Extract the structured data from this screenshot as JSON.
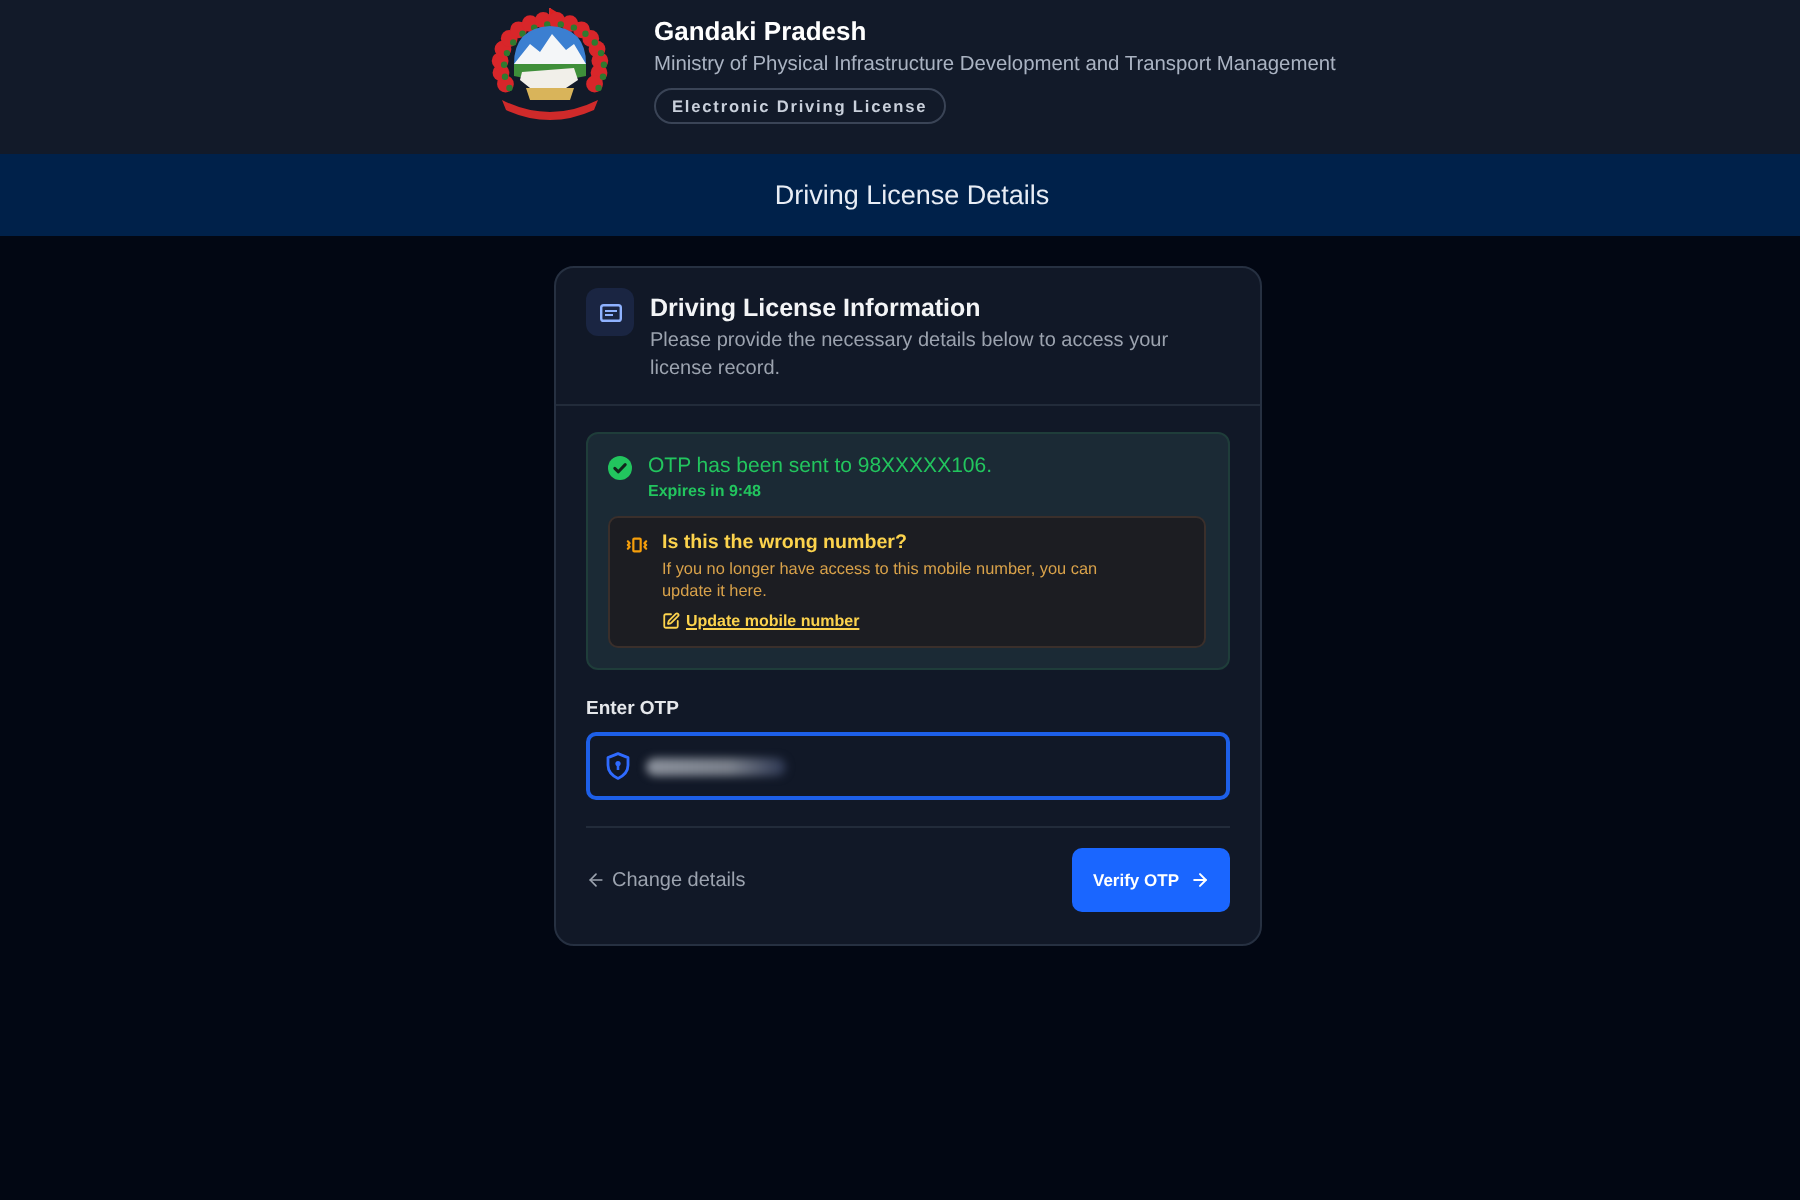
{
  "header": {
    "title": "Gandaki Pradesh",
    "subtitle": "Ministry of Physical Infrastructure Development and Transport Management",
    "badge": "Electronic Driving License"
  },
  "banner": {
    "title": "Driving License Details"
  },
  "card": {
    "title": "Driving License Information",
    "description": "Please provide the necessary details below to access your license record.",
    "otp_notice": {
      "kind": "success",
      "message": "OTP has been sent to 98XXXXX106.",
      "expiry": "Expires in 9:48"
    },
    "warning": {
      "title": "Is this the wrong number?",
      "message": "If you no longer have access to this mobile number, you can update it here.",
      "link": "Update mobile number"
    },
    "otp_field": {
      "label": "Enter OTP",
      "focused": true
    },
    "back_link": "Change details",
    "submit_button": "Verify OTP"
  }
}
